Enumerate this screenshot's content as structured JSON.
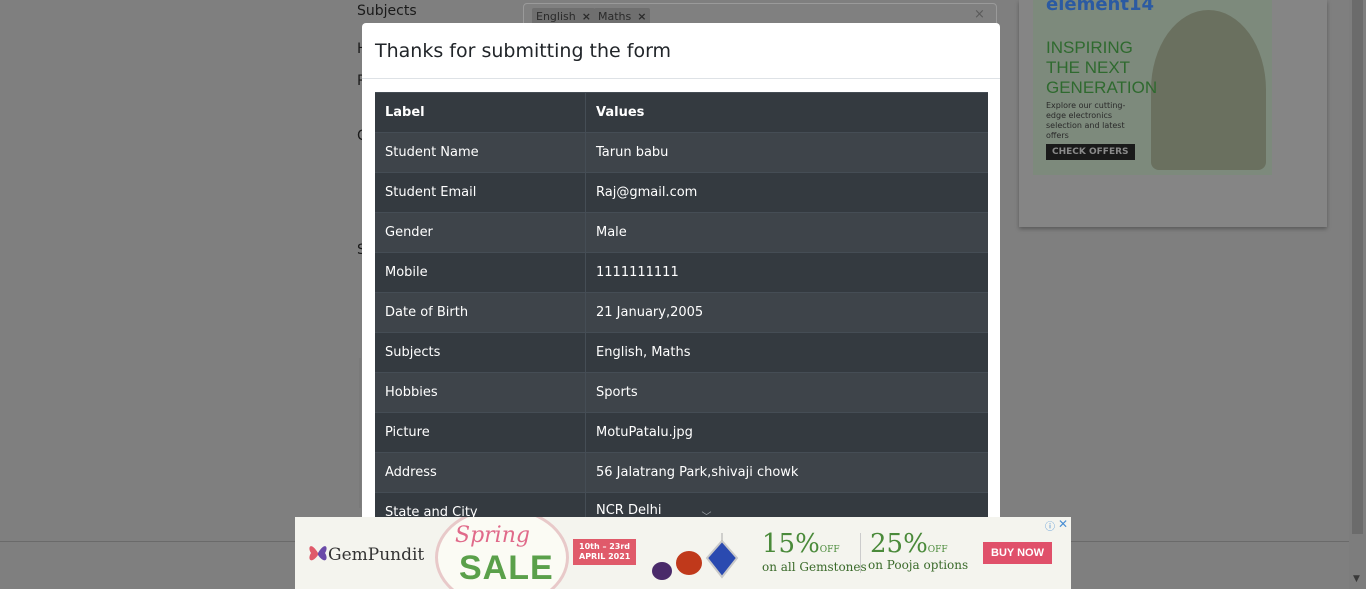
{
  "background_form": {
    "labels": [
      {
        "key": "subjects",
        "text": "Subjects"
      },
      {
        "key": "h",
        "text": "H"
      },
      {
        "key": "p",
        "text": "P"
      },
      {
        "key": "c",
        "text": "C"
      },
      {
        "key": "s",
        "text": "S"
      }
    ],
    "subject_chips": [
      "English",
      "Maths"
    ],
    "chip_remove": "×",
    "clear_icon": "×"
  },
  "ad_top": {
    "logo": "element14",
    "tagline_lines": [
      "INSPIRING",
      "THE NEXT",
      "GENERATION"
    ],
    "description": "Explore our cutting-edge electronics selection and latest offers",
    "cta": "CHECK OFFERS"
  },
  "modal": {
    "title": "Thanks for submitting the form",
    "table": {
      "headers": [
        "Label",
        "Values"
      ],
      "rows": [
        {
          "label": "Student Name",
          "value": "Tarun babu"
        },
        {
          "label": "Student Email",
          "value": "Raj@gmail.com"
        },
        {
          "label": "Gender",
          "value": "Male"
        },
        {
          "label": "Mobile",
          "value": "1111111111"
        },
        {
          "label": "Date of Birth",
          "value": "21 January,2005"
        },
        {
          "label": "Subjects",
          "value": "English, Maths"
        },
        {
          "label": "Hobbies",
          "value": "Sports"
        },
        {
          "label": "Picture",
          "value": "MotuPatalu.jpg"
        },
        {
          "label": "Address",
          "value": "56 Jalatrang Park,shivaji chowk"
        },
        {
          "label": "State and City",
          "value": "NCR Delhi"
        }
      ]
    }
  },
  "banner_ad": {
    "brand": "GemPundit",
    "spring": "Spring",
    "sale": "SALE",
    "dates": [
      "10th – 23rd",
      "APRIL 2021"
    ],
    "offer1_pct": "15%",
    "offer1_off": "OFF",
    "offer1_sub": "on all Gemstones",
    "offer2_pct": "25%",
    "offer2_off": "OFF",
    "offer2_sub": "on Pooja options",
    "cta": "BUY NOW",
    "adchoices_icon": "ⓘ",
    "close_icon": "✕"
  },
  "colors": {
    "backdrop": "#7f7f7f",
    "table_dark": "#343a40",
    "table_striped": "#3e444a",
    "buy_button": "#e0506a"
  }
}
